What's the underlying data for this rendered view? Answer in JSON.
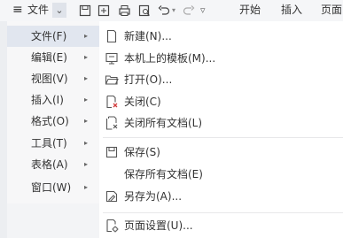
{
  "toolbar": {
    "hamburger_icon": "≡",
    "file_label": "文件",
    "dropdown_icon": "⌄",
    "overflow_icon": "▿",
    "tab_start": "开始",
    "tab_insert": "插入",
    "tab_page": "页面"
  },
  "menu": {
    "items": [
      {
        "label": "文件(F)",
        "arrow": "▸"
      },
      {
        "label": "编辑(E)",
        "arrow": "▸"
      },
      {
        "label": "视图(V)",
        "arrow": "▸"
      },
      {
        "label": "插入(I)",
        "arrow": "▸"
      },
      {
        "label": "格式(O)",
        "arrow": "▸"
      },
      {
        "label": "工具(T)",
        "arrow": "▸"
      },
      {
        "label": "表格(A)",
        "arrow": "▸"
      },
      {
        "label": "窗口(W)",
        "arrow": "▸"
      }
    ]
  },
  "submenu": {
    "items": [
      {
        "label": "新建(N)...",
        "icon": "new-doc-icon"
      },
      {
        "label": "本机上的模板(M)...",
        "icon": "template-icon"
      },
      {
        "label": "打开(O)...",
        "icon": "folder-open-icon"
      },
      {
        "label": "关闭(C)",
        "icon": "close-doc-icon"
      },
      {
        "label": "关闭所有文档(L)",
        "icon": "close-all-icon"
      },
      {
        "label": "保存(S)",
        "icon": "save-icon"
      },
      {
        "label": "保存所有文档(E)",
        "icon": ""
      },
      {
        "label": "另存为(A)...",
        "icon": "save-as-icon"
      },
      {
        "label": "页面设置(U)...",
        "icon": "page-setup-icon"
      }
    ]
  }
}
